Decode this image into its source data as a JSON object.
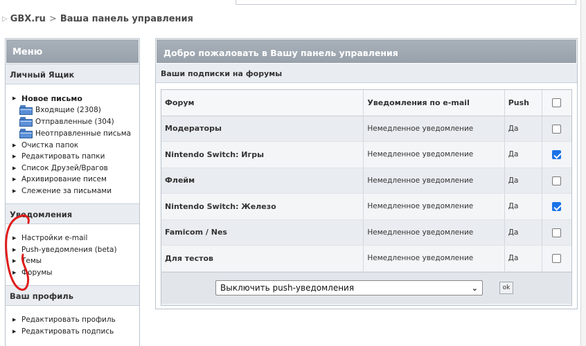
{
  "breadcrumb": {
    "site": "GBX.ru",
    "separator": ">",
    "page": "Ваша панель управления"
  },
  "sidebar": {
    "title": "Меню",
    "sections": {
      "mailbox": {
        "title": "Личный Ящик",
        "new_message": "Новое письмо",
        "folders": [
          "Входящие (2308)",
          "Отправленные (304)",
          "Неотправленные письма"
        ],
        "items": [
          "Очистка папок",
          "Редактировать папки",
          "Список Друзей/Врагов",
          "Архивирование писем",
          "Слежение за письмами"
        ]
      },
      "notifications": {
        "title": "Уведомления",
        "items": [
          "Настройки e-mail",
          "Push-уведомления (beta)",
          "Темы",
          "Форумы"
        ]
      },
      "profile": {
        "title": "Ваш профиль",
        "items": [
          "Редактировать профиль",
          "Редактировать подпись"
        ]
      }
    }
  },
  "main": {
    "title": "Добро пожаловать в Вашу панель управления",
    "subtitle": "Ваши подписки на форумы",
    "table": {
      "headers": {
        "forum": "Форум",
        "notify": "Уведомления по e-mail",
        "push": "Push"
      },
      "rows": [
        {
          "forum": "Модераторы",
          "notify": "Немедленное уведомление",
          "push": "Да",
          "checked": false
        },
        {
          "forum": "Nintendo Switch: Игры",
          "notify": "Немедленное уведомление",
          "push": "Да",
          "checked": true
        },
        {
          "forum": "Флейм",
          "notify": "Немедленное уведомление",
          "push": "Да",
          "checked": false
        },
        {
          "forum": "Nintendo Switch: Железо",
          "notify": "Немедленное уведомление",
          "push": "Да",
          "checked": true
        },
        {
          "forum": "Famicom / Nes",
          "notify": "Немедленное уведомление",
          "push": "Да",
          "checked": false
        },
        {
          "forum": "Для тестов",
          "notify": "Немедленное уведомление",
          "push": "Да",
          "checked": false
        }
      ]
    },
    "action_select": "Выключить push-уведомления",
    "ok_label": "ok"
  },
  "colors": {
    "header": "#a1aab3",
    "checkbox_checked": "#1a73e8",
    "annotation": "#e01b1b"
  }
}
